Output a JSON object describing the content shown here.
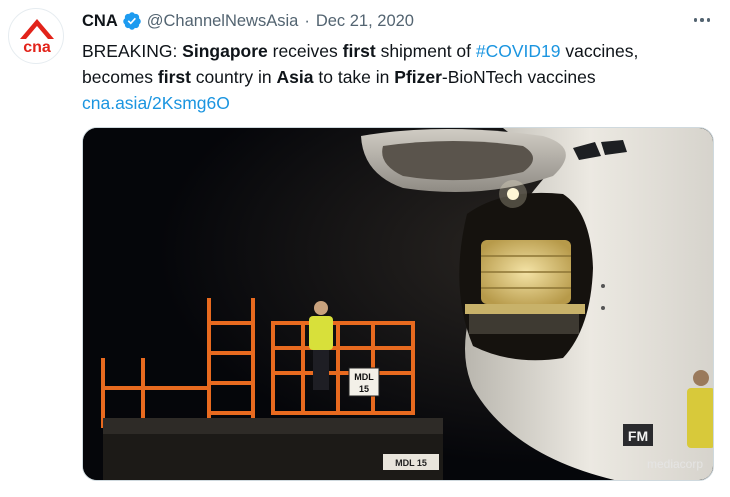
{
  "tweet": {
    "display_name": "CNA",
    "handle": "@ChannelNewsAsia",
    "separator": "·",
    "date": "Dec 21, 2020",
    "text": {
      "t1": "BREAKING: ",
      "b1": "Singapore",
      "t2": " receives ",
      "b2": "first",
      "t3": " shipment of ",
      "hashtag": "#COVID19",
      "t4": " vaccines, becomes ",
      "b3": "first",
      "t5": " country in ",
      "b4": "Asia",
      "t6": " to take in ",
      "b5": "Pfizer",
      "t7": "-BioNTech vaccines",
      "link": "cna.asia/2Ksmg6O"
    }
  },
  "avatar": {
    "logo_text": "cna",
    "brand_color": "#e2231a"
  },
  "media": {
    "loader_label_top": "MDL",
    "loader_label_num": "15",
    "loader_base_label": "MDL 15",
    "plane_marking": "FM",
    "watermark": "mediacorp"
  },
  "colors": {
    "link": "#1b95e0",
    "verified": "#1d9bf0",
    "secondary_text": "#536471"
  },
  "icons": [
    "verified-badge-icon",
    "more-options-icon"
  ]
}
